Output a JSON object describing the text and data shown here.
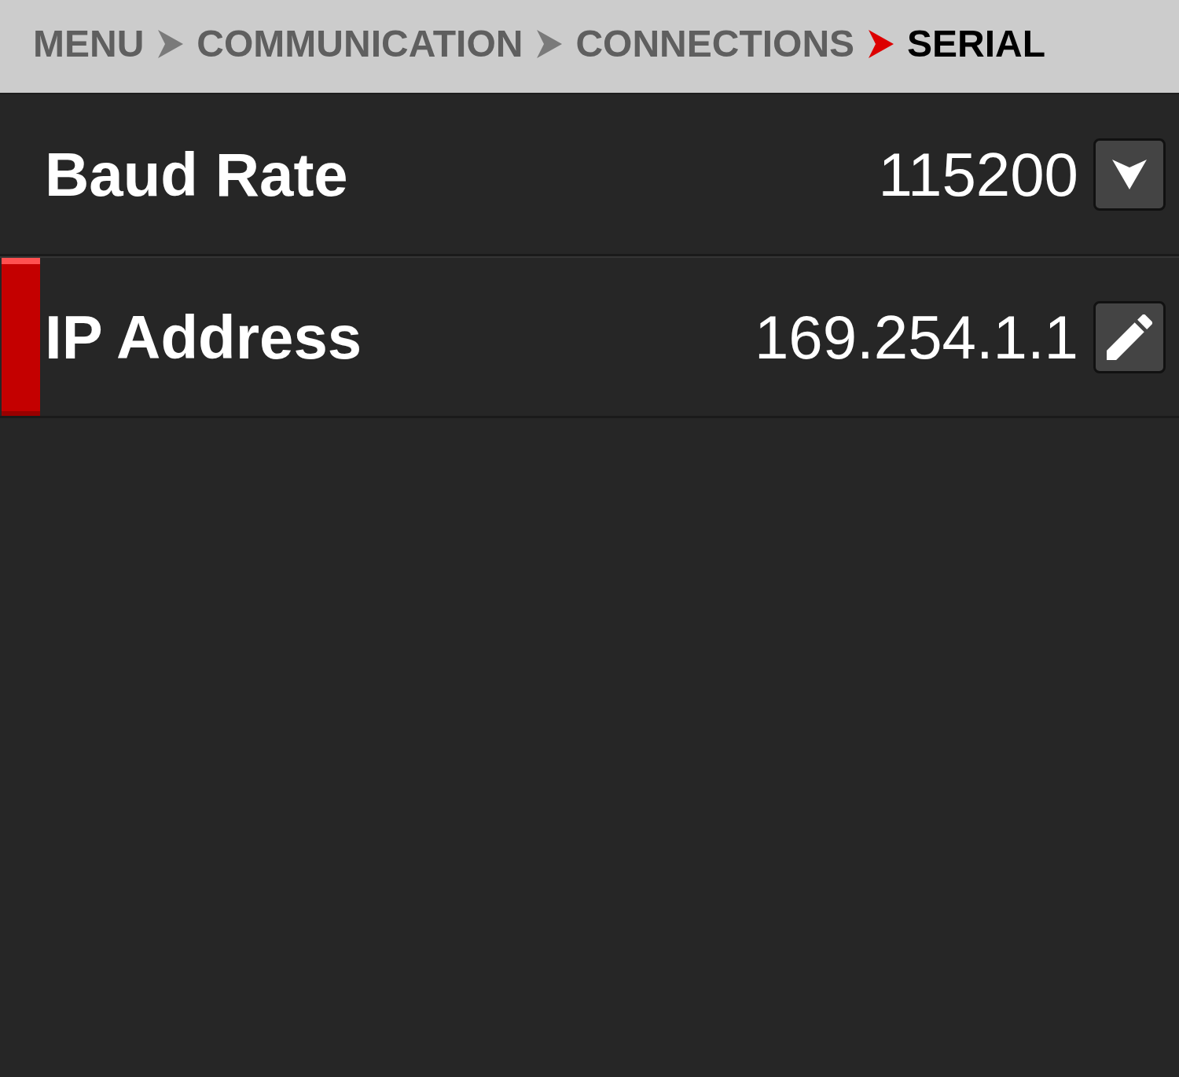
{
  "breadcrumb": [
    {
      "label": "MENU",
      "selected": false
    },
    {
      "label": "COMMUNICATION",
      "selected": false
    },
    {
      "label": "CONNECTIONS",
      "selected": false
    },
    {
      "label": "SERIAL",
      "selected": true
    }
  ],
  "rows": [
    {
      "label": "Baud Rate",
      "value": "115200",
      "kind": "dropdown",
      "selected": false
    },
    {
      "label": "IP Address",
      "value": "169.254.1.1",
      "kind": "edit",
      "selected": true
    }
  ]
}
